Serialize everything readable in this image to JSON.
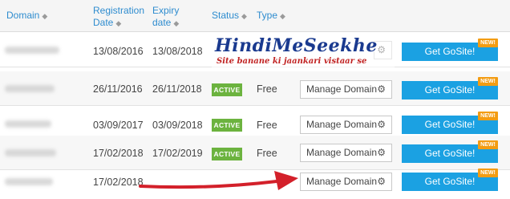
{
  "columns": {
    "domain": "Domain",
    "registration": "Registration Date",
    "expiry": "Expiry date",
    "status": "Status",
    "type": "Type"
  },
  "rows": [
    {
      "registration": "13/08/2016",
      "expiry": "13/08/2018",
      "status": "",
      "type": "",
      "manage": "",
      "gosite": "Get GoSite!",
      "new": "NEW!"
    },
    {
      "registration": "26/11/2016",
      "expiry": "26/11/2018",
      "status": "ACTIVE",
      "type": "Free",
      "manage": "Manage Domain",
      "gosite": "Get GoSite!",
      "new": "NEW!"
    },
    {
      "registration": "03/09/2017",
      "expiry": "03/09/2018",
      "status": "ACTIVE",
      "type": "Free",
      "manage": "Manage Domain",
      "gosite": "Get GoSite!",
      "new": "NEW!"
    },
    {
      "registration": "17/02/2018",
      "expiry": "17/02/2019",
      "status": "ACTIVE",
      "type": "Free",
      "manage": "Manage Domain",
      "gosite": "Get GoSite!",
      "new": "NEW!"
    },
    {
      "registration": "17/02/2018",
      "expiry": "",
      "status": "",
      "type": "",
      "manage": "Manage Domain",
      "gosite": "Get GoSite!",
      "new": "NEW!"
    }
  ],
  "watermark": {
    "title": "HindiMeSeekhe",
    "subtitle": "Site banane ki jaankari vistaar se"
  },
  "icons": {
    "sort": "sort-icon",
    "gear": "gear-icon",
    "arrow": "red-arrow-pointer"
  },
  "colors": {
    "header_text": "#2e8ccf",
    "active_badge": "#6cb33f",
    "gosite_button": "#1ba1e2",
    "new_tag": "#f39c12",
    "arrow": "#d3202a"
  }
}
